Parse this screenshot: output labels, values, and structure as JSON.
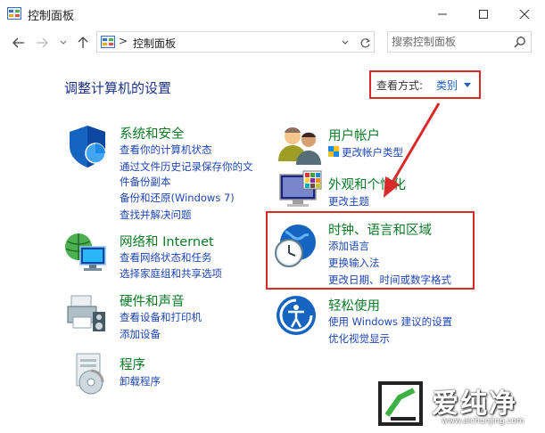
{
  "window": {
    "title": "控制面板"
  },
  "nav": {
    "breadcrumb_sep": ">",
    "address": "控制面板",
    "search_placeholder": "搜索控制面板"
  },
  "main": {
    "title": "调整计算机的设置",
    "view_by_label": "查看方式:",
    "view_by_value": "类别"
  },
  "categories": [
    {
      "title": "系统和安全",
      "icon": "shield-icon",
      "links": [
        "查看你的计算机状态",
        "通过文件历史记录保存你的文",
        "件备份副本",
        "备份和还原(Windows 7)",
        "查找并解决问题"
      ]
    },
    {
      "title": "网络和 Internet",
      "icon": "network-icon",
      "links": [
        "查看网络状态和任务",
        "选择家庭组和共享选项"
      ]
    },
    {
      "title": "硬件和声音",
      "icon": "printer-icon",
      "links": [
        "查看设备和打印机",
        "添加设备"
      ]
    },
    {
      "title": "程序",
      "icon": "programs-icon",
      "links": [
        "卸载程序"
      ]
    },
    {
      "title": "用户帐户",
      "icon": "users-icon",
      "links": [
        "更改帐户类型"
      ]
    },
    {
      "title": "外观和个性化",
      "icon": "monitor-icon",
      "links": [
        "更改主题"
      ]
    },
    {
      "title": "时钟、语言和区域",
      "icon": "globe-clock-icon",
      "links": [
        "添加语言",
        "更换输入法",
        "更改日期、时间或数字格式"
      ]
    },
    {
      "title": "轻松使用",
      "icon": "accessibility-icon",
      "links": [
        "使用 Windows 建议的设置",
        "优化视觉显示"
      ]
    }
  ],
  "watermark": {
    "text": "爱纯净",
    "url": "www.aichunjing.com"
  },
  "colors": {
    "category_title": "#0b7a26",
    "link": "#1e45b4",
    "annotation": "#d92a2a"
  }
}
